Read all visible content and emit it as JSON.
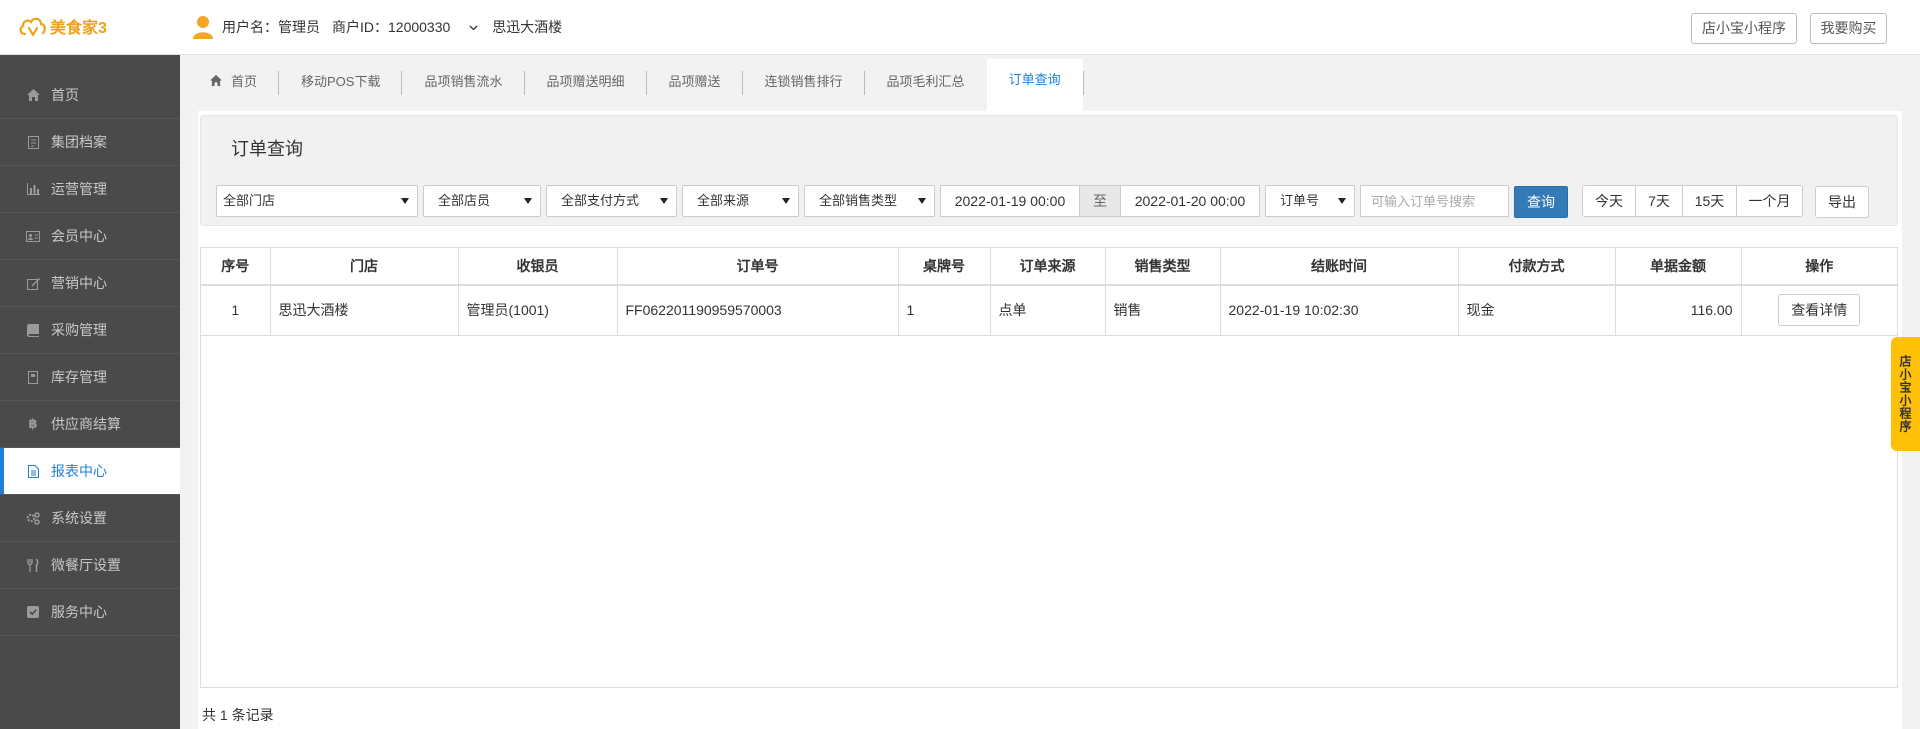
{
  "app": {
    "logo_text": "美食家3"
  },
  "header": {
    "username_label": "用户名：管理员",
    "merchant_id": "商户ID：12000330",
    "shop_name": "思迅大酒楼",
    "btn_mini_program": "店小宝小程序",
    "btn_buy": "我要购买"
  },
  "sidebar": {
    "items": [
      {
        "label": "首页",
        "icon": "home-icon"
      },
      {
        "label": "集团档案",
        "icon": "file-icon"
      },
      {
        "label": "运营管理",
        "icon": "bar-chart-icon"
      },
      {
        "label": "会员中心",
        "icon": "id-card-icon"
      },
      {
        "label": "营销中心",
        "icon": "edit-icon"
      },
      {
        "label": "采购管理",
        "icon": "book-icon"
      },
      {
        "label": "库存管理",
        "icon": "inventory-icon"
      },
      {
        "label": "供应商结算",
        "icon": "bitcoin-icon"
      },
      {
        "label": "报表中心",
        "icon": "report-icon",
        "active": true
      },
      {
        "label": "系统设置",
        "icon": "gears-icon"
      },
      {
        "label": "微餐厅设置",
        "icon": "cutlery-icon"
      },
      {
        "label": "服务中心",
        "icon": "check-square-icon"
      }
    ]
  },
  "tabs": [
    {
      "label": "首页",
      "icon": "home-icon"
    },
    {
      "label": "移动POS下载"
    },
    {
      "label": "品项销售流水"
    },
    {
      "label": "品项赠送明细"
    },
    {
      "label": "品项赠送"
    },
    {
      "label": "连锁销售排行"
    },
    {
      "label": "品项毛利汇总"
    },
    {
      "label": "订单查询",
      "active": true
    }
  ],
  "query": {
    "title": "订单查询",
    "store_select": "全部门店",
    "cashier_select": "全部店员",
    "payment_select": "全部支付方式",
    "source_select": "全部来源",
    "sale_type_select": "全部销售类型",
    "date_start": "2022-01-19 00:00",
    "date_sep": "至",
    "date_end": "2022-01-20 00:00",
    "order_field_select": "订单号",
    "search_placeholder": "可输入订单号搜索",
    "btn_query": "查询",
    "range_buttons": [
      "今天",
      "7天",
      "15天",
      "一个月"
    ],
    "btn_export": "导出"
  },
  "table": {
    "headers": [
      "序号",
      "门店",
      "收银员",
      "订单号",
      "桌牌号",
      "订单来源",
      "销售类型",
      "结账时间",
      "付款方式",
      "单据金额",
      "操作"
    ],
    "rows": [
      {
        "index": "1",
        "store": "思迅大酒楼",
        "cashier": "管理员(1001)",
        "order_no": "FF062201190959570003",
        "table_no": "1",
        "source": "点单",
        "sale_type": "销售",
        "checkout_time": "2022-01-19 10:02:30",
        "payment": "现金",
        "amount": "116.00",
        "action": "查看详情"
      }
    ]
  },
  "footer": {
    "record_count": "共 1 条记录"
  },
  "float_tag": "店小宝小程序",
  "colors": {
    "accent": "#1e7fd7",
    "brand": "#f0a21e",
    "primary_button": "#337ab7",
    "sidebar_bg": "#4a4a4a",
    "float_tag": "#ffc107"
  }
}
